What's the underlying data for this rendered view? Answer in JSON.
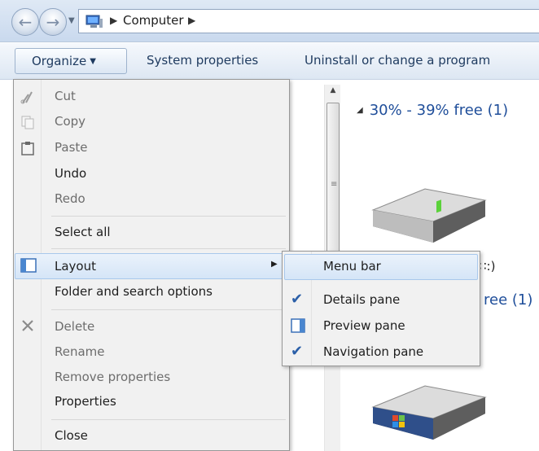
{
  "address": {
    "crumbs": [
      "Computer"
    ]
  },
  "toolbar": {
    "organize": "Organize",
    "system_properties": "System properties",
    "uninstall": "Uninstall or change a program"
  },
  "content": {
    "group1": "30% - 39% free (1)",
    "drive_suffix": "∷:)",
    "group2_tail": "ree (1)"
  },
  "organize_menu": {
    "items": [
      {
        "label": "Cut",
        "enabled": false,
        "icon": "scissors-icon"
      },
      {
        "label": "Copy",
        "enabled": false,
        "icon": "copy-icon"
      },
      {
        "label": "Paste",
        "enabled": false,
        "icon": "clipboard-icon"
      },
      {
        "label": "Undo",
        "enabled": true
      },
      {
        "label": "Redo",
        "enabled": false
      },
      {
        "label": "Select all",
        "enabled": true
      },
      {
        "label": "Layout",
        "enabled": true,
        "icon": "layout-icon",
        "submenu": true
      },
      {
        "label": "Folder and search options",
        "enabled": true
      },
      {
        "label": "Delete",
        "enabled": false,
        "icon": "delete-x-icon"
      },
      {
        "label": "Rename",
        "enabled": false
      },
      {
        "label": "Remove properties",
        "enabled": false
      },
      {
        "label": "Properties",
        "enabled": true
      },
      {
        "label": "Close",
        "enabled": true
      }
    ]
  },
  "layout_submenu": {
    "items": [
      {
        "label": "Menu bar",
        "checked": false
      },
      {
        "label": "Details pane",
        "checked": true
      },
      {
        "label": "Preview pane",
        "checked": false,
        "icon": "preview-pane-icon"
      },
      {
        "label": "Navigation pane",
        "checked": true
      }
    ]
  }
}
